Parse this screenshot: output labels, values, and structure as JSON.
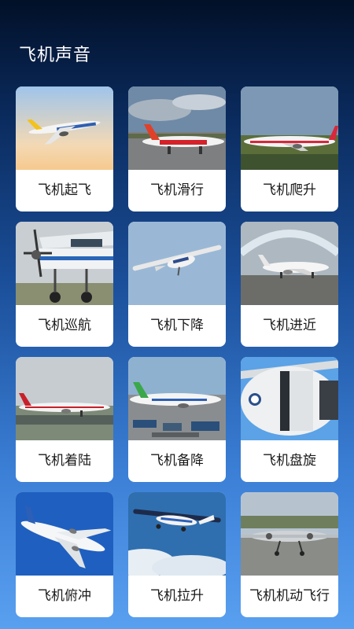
{
  "header": {
    "title": "飞机声音"
  },
  "items": [
    {
      "label": "飞机起飞",
      "scene": "takeoff"
    },
    {
      "label": "飞机滑行",
      "scene": "taxi"
    },
    {
      "label": "飞机爬升",
      "scene": "climb"
    },
    {
      "label": "飞机巡航",
      "scene": "cruise"
    },
    {
      "label": "飞机下降",
      "scene": "descent"
    },
    {
      "label": "飞机进近",
      "scene": "approach"
    },
    {
      "label": "飞机着陆",
      "scene": "landing"
    },
    {
      "label": "飞机备降",
      "scene": "diversion"
    },
    {
      "label": "飞机盘旋",
      "scene": "holding"
    },
    {
      "label": "飞机俯冲",
      "scene": "dive"
    },
    {
      "label": "飞机拉升",
      "scene": "pullup"
    },
    {
      "label": "飞机机动飞行",
      "scene": "maneuver"
    }
  ]
}
